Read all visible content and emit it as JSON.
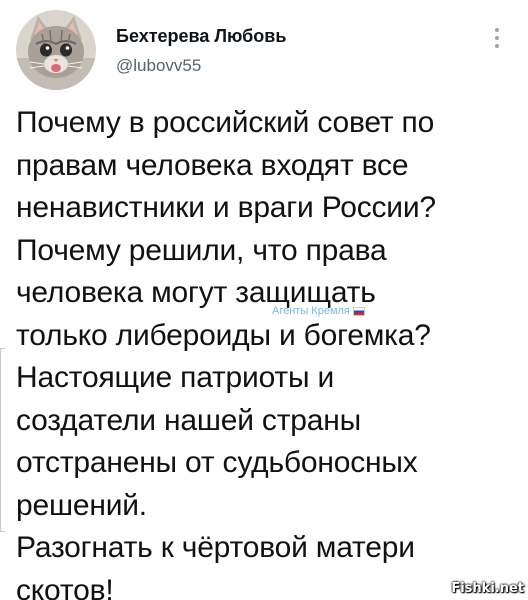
{
  "author": {
    "name": "Бехтерева Любовь",
    "handle": "@lubovv55",
    "avatar_icon": "kitten-avatar-icon"
  },
  "menu": {
    "icon": "more-vertical-icon"
  },
  "tweet": {
    "text": "Почему в российский совет по\nправам человека входят все\nненавистники и враги России?\nПочему решили, что права\nчеловека могут защищать\nтолько либероиды и богемка?\nНастоящие патриоты и\nсоздатели  нашей страны\nотстранены от судьбоносных\nрешений.\nРазогнать к чёртовой матери\nскотов!"
  },
  "watermarks": {
    "agents": "Агенты Кремля",
    "agents_flag_icon": "russian-flag-icon",
    "site": "Fishki.net"
  }
}
